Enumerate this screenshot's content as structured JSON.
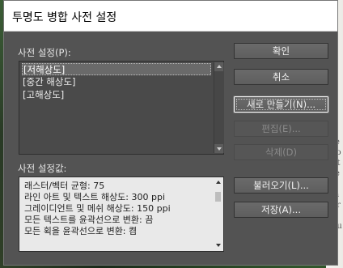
{
  "window": {
    "title": "투명도 병합 사전 설정"
  },
  "presets": {
    "label": "사전 설정(P):",
    "items": [
      {
        "label": "[저해상도]",
        "selected": true
      },
      {
        "label": "[중간 해상도]",
        "selected": false
      },
      {
        "label": "[고해상도]",
        "selected": false
      }
    ]
  },
  "summary": {
    "label": "사전 설정값:",
    "lines": [
      "래스터/벡터 균형: 75",
      "라인 아트 및 텍스트 해상도: 300 ppi",
      "그레이디언트 및 메쉬 해상도: 150 ppi",
      "모든 텍스트를 윤곽선으로 변환: 끔",
      "모든 획을 윤곽선으로 변환: 켬"
    ]
  },
  "buttons": {
    "ok": "확인",
    "cancel": "취소",
    "new": "새로 만들기(N)...",
    "edit": "편집(E)...",
    "delete": "삭제(D)",
    "load": "불러오기(L)...",
    "save": "저장(A)..."
  },
  "background": {
    "right_letter": "e",
    "right_text": [
      "te",
      "vo",
      "nt",
      "te",
      "n",
      "la",
      "ar",
      "c",
      "pu",
      "e",
      "h"
    ]
  },
  "colors": {
    "dialog_bg": "#535353",
    "title_bg": "#ffffff",
    "button_bg": "#646464",
    "list_selected": "#6a6a6a"
  }
}
